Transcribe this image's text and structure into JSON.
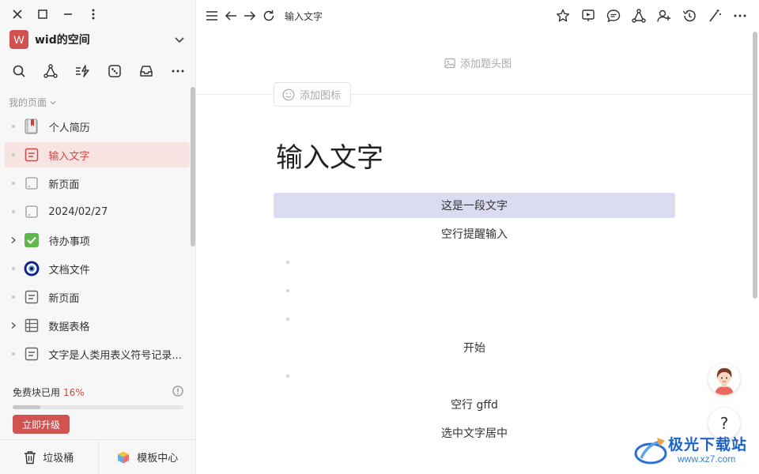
{
  "sidebar": {
    "workspace": {
      "logo": "W",
      "name": "wid的空间"
    },
    "section_title": "我的页面",
    "items": [
      {
        "label": "个人简历",
        "icon": "bookmark-book-icon",
        "lead": "dot"
      },
      {
        "label": "输入文字",
        "icon": "doc-icon",
        "lead": "dot",
        "active": true
      },
      {
        "label": "新页面",
        "icon": "blank-page-icon",
        "lead": "dot"
      },
      {
        "label": "2024/02/27",
        "icon": "blank-page-icon",
        "lead": "dot"
      },
      {
        "label": "待办事项",
        "icon": "checkbox-icon",
        "lead": "chevron"
      },
      {
        "label": "文档文件",
        "icon": "eye-charm-icon",
        "lead": "dot"
      },
      {
        "label": "新页面",
        "icon": "doc-icon",
        "lead": "dot"
      },
      {
        "label": "数据表格",
        "icon": "table-icon",
        "lead": "chevron"
      },
      {
        "label": "文字是人类用表义符号记录...",
        "icon": "doc-icon",
        "lead": "dot"
      }
    ],
    "quota": {
      "label": "免费块已用",
      "percent_text": "16%",
      "fraction": 0.16,
      "upgrade_label": "立即升级"
    },
    "footer": {
      "trash_label": "垃圾桶",
      "templates_label": "模板中心"
    }
  },
  "main": {
    "breadcrumb": "输入文字",
    "add_cover": "添加题头图",
    "add_icon": "添加图标",
    "title": "输入文字",
    "blocks": [
      {
        "text": "这是一段文字",
        "highlight": true
      },
      {
        "text": "空行提醒输入"
      },
      {
        "text": "开始"
      },
      {
        "text": "空行 gffd"
      },
      {
        "text": "选中文字居中"
      }
    ],
    "help": "?"
  },
  "watermark": {
    "text": "极光下载站",
    "url": "www.xz7.com"
  },
  "colors": {
    "accent": "#d2524f",
    "highlight": "#dcdcf0",
    "active_bg": "#f7e3e2"
  }
}
